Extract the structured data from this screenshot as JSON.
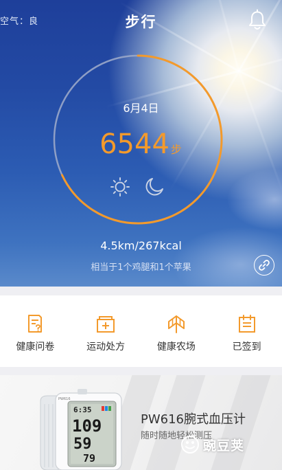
{
  "header": {
    "air_quality": "空气：良",
    "title": "步行"
  },
  "ring": {
    "date": "6月4日",
    "steps": "6544",
    "steps_unit": "步",
    "progress": 0.68
  },
  "stats": {
    "distance_calories": "4.5km/267kcal",
    "equivalent": "相当于1个鸡腿和1个苹果"
  },
  "menu": {
    "items": [
      {
        "label": "健康问卷",
        "icon": "questionnaire-icon"
      },
      {
        "label": "运动处方",
        "icon": "prescription-icon"
      },
      {
        "label": "健康农场",
        "icon": "farm-icon"
      },
      {
        "label": "已签到",
        "icon": "calendar-checkin-icon"
      }
    ]
  },
  "banner": {
    "product_name": "PW616腕式血压计",
    "product_desc": "随时随地轻松测压",
    "device_time": "6:35",
    "device_readings": [
      "109",
      "59",
      "79"
    ],
    "device_brand": "PW616"
  },
  "watermark": {
    "text": "豌豆荚"
  },
  "colors": {
    "accent": "#f39a2c",
    "hero_blue": "#234aa4",
    "ring_track": "#9aa7c9"
  }
}
